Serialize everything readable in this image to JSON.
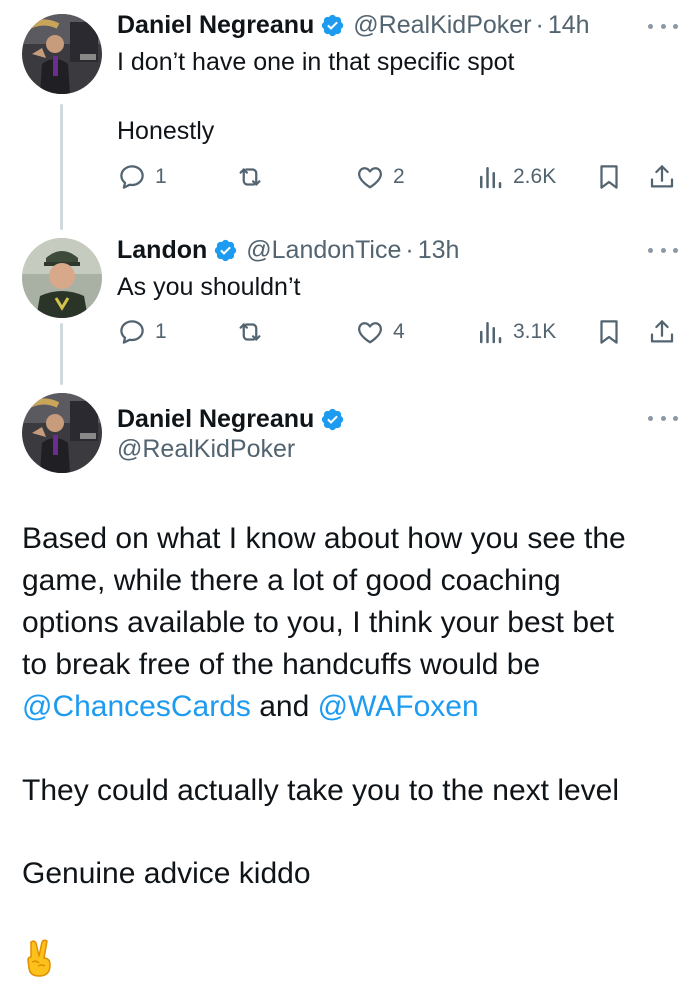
{
  "tweets": [
    {
      "display_name": "Daniel Negreanu",
      "handle": "@RealKidPoker",
      "separator": "·",
      "time": "14h",
      "text_lines": [
        "I don’t have one in that specific spot",
        "",
        "Honestly"
      ],
      "stats": {
        "replies": "1",
        "reposts": "",
        "likes": "2",
        "views": "2.6K"
      }
    },
    {
      "display_name": "Landon",
      "handle": "@LandonTice",
      "separator": "·",
      "time": "13h",
      "text_lines": [
        "As you shouldn’t"
      ],
      "stats": {
        "replies": "1",
        "reposts": "",
        "likes": "4",
        "views": "3.1K"
      }
    }
  ],
  "main_tweet": {
    "display_name": "Daniel Negreanu",
    "handle": "@RealKidPoker",
    "lines": [
      "Based on what I know about how you see the",
      "game, while there a lot of good coaching",
      "options available to you, I think your best bet",
      "to break free of the handcuffs would be"
    ],
    "mention_1": "@ChancesCards",
    "mention_joiner": " and ",
    "mention_2": "@WAFoxen",
    "paragraph_2": "They could actually take you to the next level",
    "paragraph_3": "Genuine advice kiddo",
    "emoji": "victory-hand"
  },
  "icons": {
    "reply": "reply-icon",
    "repost": "repost-icon",
    "like": "like-icon",
    "views": "views-icon",
    "bookmark": "bookmark-icon",
    "share": "share-icon",
    "verified": "verified-badge-icon",
    "more": "more-icon"
  },
  "colors": {
    "text": "#0f1419",
    "secondary": "#536471",
    "link": "#1d9bf0",
    "verified": "#1d9bf0",
    "thread_line": "#cfd9de"
  }
}
